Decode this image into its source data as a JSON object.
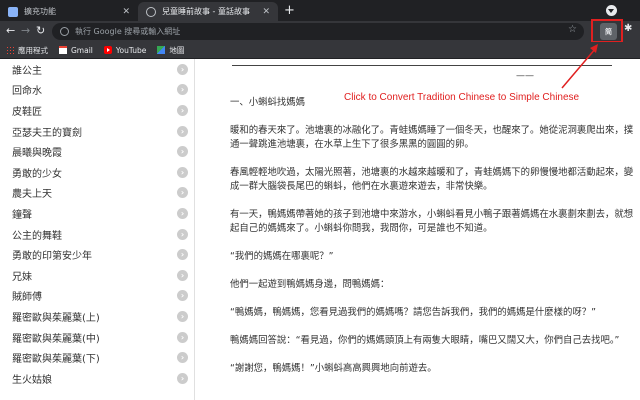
{
  "tabs": [
    {
      "label": "擴充功能",
      "active": false
    },
    {
      "label": "兒童睡前故事 - 童話故事",
      "active": true
    }
  ],
  "new_tab_label": "+",
  "toolbar": {
    "omnibox_placeholder": "執行 Google 搜尋或輸入網址",
    "extension_label": "简"
  },
  "bookmarks": [
    {
      "label": "應用程式",
      "icon": "apps-icon"
    },
    {
      "label": "Gmail",
      "icon": "gmail-icon"
    },
    {
      "label": "YouTube",
      "icon": "youtube-icon"
    },
    {
      "label": "地圖",
      "icon": "maps-icon"
    }
  ],
  "sidebar": {
    "items": [
      {
        "label": "誰公主"
      },
      {
        "label": "回命水"
      },
      {
        "label": "皮鞋匠"
      },
      {
        "label": "亞瑟夫王的寶劍"
      },
      {
        "label": "晨曦與晚霞"
      },
      {
        "label": "勇敢的少女"
      },
      {
        "label": "農夫上天"
      },
      {
        "label": "鐘聲"
      },
      {
        "label": "公主的舞鞋"
      },
      {
        "label": "勇敢的印第安少年"
      },
      {
        "label": "兄妹"
      },
      {
        "label": "賊師傅"
      },
      {
        "label": "羅密歐與茱麗葉(上)"
      },
      {
        "label": "羅密歐與茱麗葉(中)"
      },
      {
        "label": "羅密歐與茱麗葉(下)"
      },
      {
        "label": "生火姑娘"
      }
    ]
  },
  "article": {
    "dash": "——",
    "heading": "一、小蝌蚪找媽媽",
    "paragraphs": [
      "暖和的春天來了。池塘裏的冰融化了。青蛙媽媽睡了一個冬天，也醒來了。她從泥洞裏爬出來，撲通一聲跳進池塘裏，在水草上生下了很多黑黑的圓圓的卵。",
      "春風輕輕地吹過，太陽光照著，池塘裏的水越來越暖和了，青蛙媽媽下的卵慢慢地都活動起來，變成一群大腦袋長尾巴的蝌蚪，他們在水裏遊來遊去，非常快樂。",
      "有一天，鴨媽媽帶著她的孩子到池塘中來游水，小蝌蚪看見小鴨子跟著媽媽在水裏劃來劃去，就想起自己的媽媽來了。小蝌蚪你問我，我問你，可是誰也不知道。",
      "“我們的媽媽在哪裏呢？”",
      "他們一起遊到鴨媽媽身邊，問鴨媽媽：",
      "“鴨媽媽，鴨媽媽，您看見過我們的媽媽嗎？請您告訴我們，我們的媽媽是什麼樣的呀？”",
      "鴨媽媽回答說：“看見過，你們的媽媽頭頂上有兩隻大眼睛，嘴巴又闊又大，你們自己去找吧。”",
      "“謝謝您，鴨媽媽！”小蝌蚪高高興興地向前遊去。"
    ]
  },
  "annotation": {
    "text": "Click to Convert Tradition Chinese to Simple Chinese",
    "color": "#e02020"
  }
}
